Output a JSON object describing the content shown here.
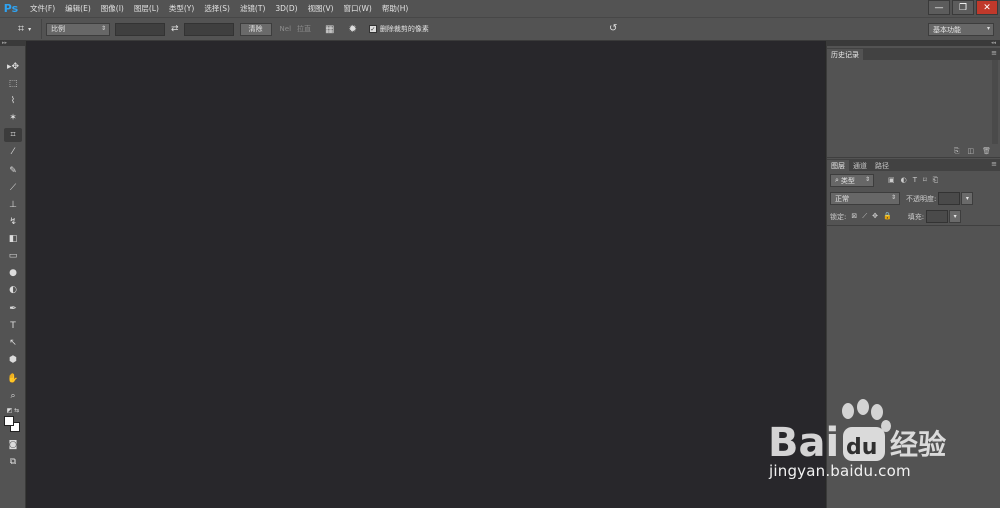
{
  "app": {
    "logo": "Ps",
    "menu": [
      "文件(F)",
      "编辑(E)",
      "图像(I)",
      "图层(L)",
      "类型(Y)",
      "选择(S)",
      "滤镜(T)",
      "3D(D)",
      "视图(V)",
      "窗口(W)",
      "帮助(H)"
    ],
    "window_controls": {
      "minimize": "—",
      "restore": "❐",
      "close": "✕"
    }
  },
  "options": {
    "ratio_select": "比例",
    "clear_button": "清除",
    "straighten_label": "拉直",
    "straighten_icon_text": "Nel",
    "delete_cropped_label": "删除裁剪的像素",
    "delete_cropped_checked": true,
    "workspace_select": "基本功能"
  },
  "panels": {
    "history_tab": "历史记录",
    "layers_tabs": [
      "图层",
      "通道",
      "路径"
    ],
    "filter_kind": "类型",
    "blend_mode": "正常",
    "opacity_label": "不透明度:",
    "lock_label": "锁定:",
    "fill_label": "填充:"
  },
  "watermark": {
    "brand": "Bai",
    "brand_du": "du",
    "brand_cn": "经验",
    "url": "jingyan.baidu.com"
  },
  "icons": {
    "crop": "crop-icon",
    "swap": "swap-icon",
    "grid": "grid-overlay-icon",
    "gear": "gear-icon",
    "reset": "reset-icon"
  },
  "colors": {
    "chrome": "#535353",
    "canvas": "#28272b",
    "ps_blue": "#2fa3f2"
  }
}
